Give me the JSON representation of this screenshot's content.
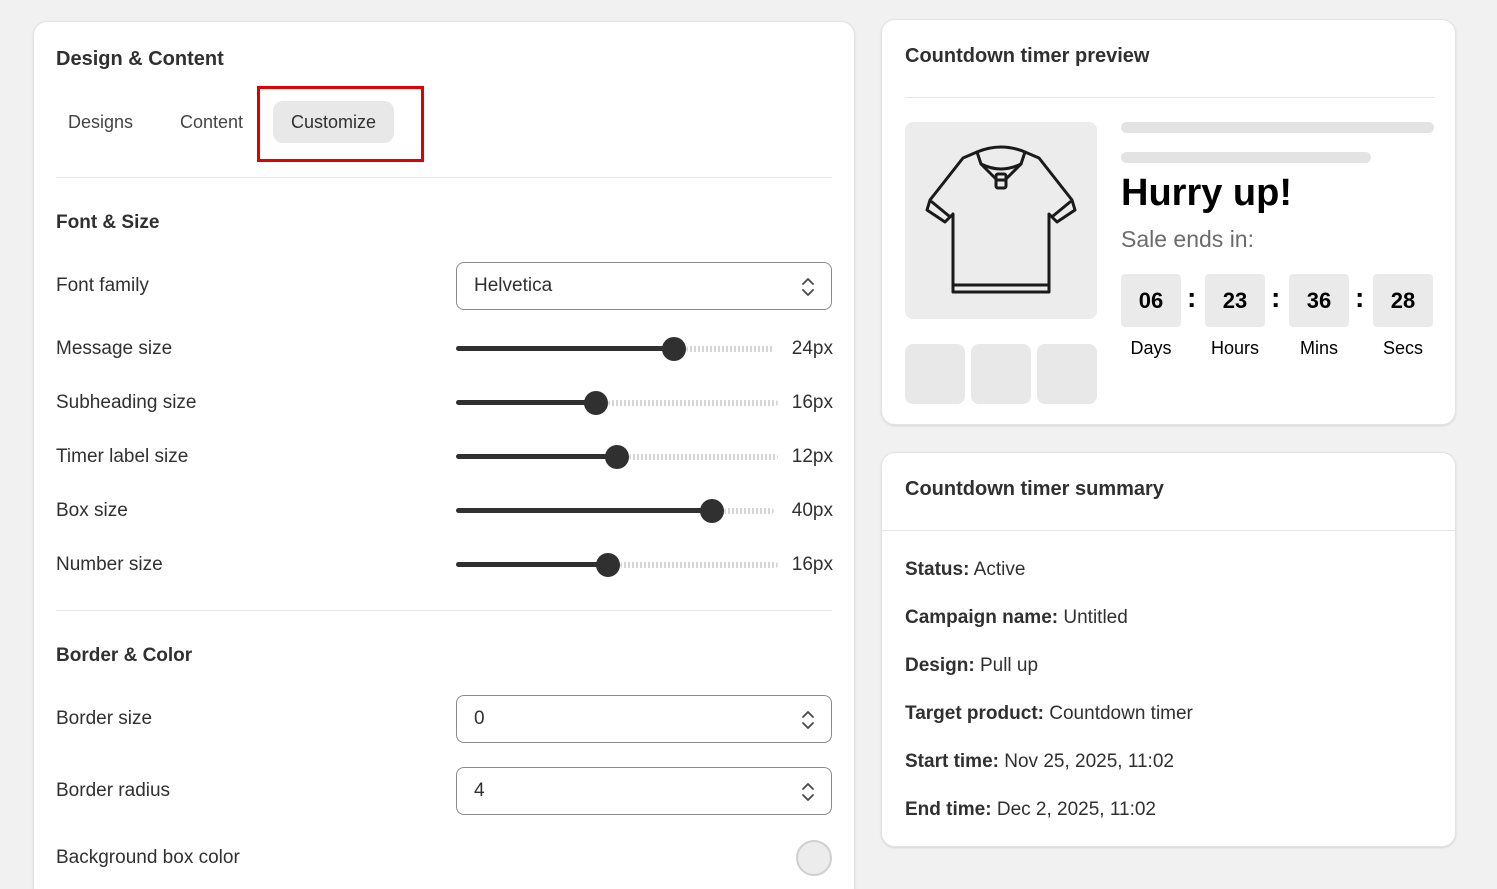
{
  "left": {
    "title": "Design & Content",
    "tabs": [
      "Designs",
      "Content",
      "Customize"
    ],
    "font_section": "Font & Size",
    "font_family": {
      "label": "Font family",
      "value": "Helvetica"
    },
    "sliders": [
      {
        "label": "Message size",
        "value_text": "24px",
        "fraction": 0.7
      },
      {
        "label": "Subheading size",
        "value_text": "16px",
        "fraction": 0.43
      },
      {
        "label": "Timer label size",
        "value_text": "12px",
        "fraction": 0.5
      },
      {
        "label": "Box size",
        "value_text": "40px",
        "fraction": 0.83
      },
      {
        "label": "Number size",
        "value_text": "16px",
        "fraction": 0.47
      }
    ],
    "border_section": "Border & Color",
    "border_size": {
      "label": "Border size",
      "value": "0"
    },
    "border_radius": {
      "label": "Border radius",
      "value": "4"
    },
    "bg_color": {
      "label": "Background box color",
      "color": "#ececec"
    }
  },
  "preview": {
    "title": "Countdown timer preview",
    "headline": "Hurry up!",
    "subheading": "Sale ends in:",
    "timer": [
      {
        "value": "06",
        "label": "Days"
      },
      {
        "value": "23",
        "label": "Hours"
      },
      {
        "value": "36",
        "label": "Mins"
      },
      {
        "value": "28",
        "label": "Secs"
      }
    ],
    "separator": ":"
  },
  "summary": {
    "title": "Countdown timer summary",
    "rows": [
      {
        "key": "Status:",
        "value": "Active"
      },
      {
        "key": "Campaign name:",
        "value": "Untitled"
      },
      {
        "key": "Design:",
        "value": "Pull up"
      },
      {
        "key": "Target product:",
        "value": "Countdown timer"
      },
      {
        "key": "Start time:",
        "value": "Nov 25, 2025, 11:02"
      },
      {
        "key": "End time:",
        "value": "Dec 2, 2025, 11:02"
      }
    ]
  },
  "colors": {
    "accent_dark": "#303030",
    "highlight": "#e00000"
  }
}
